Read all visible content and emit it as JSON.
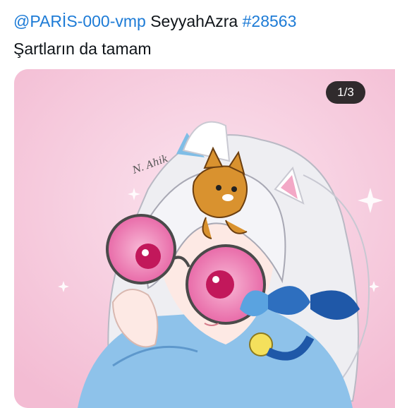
{
  "post": {
    "mention": "@PARİS-000-vmp",
    "user": "SeyyahAzra",
    "hashtag": "#28563",
    "text": "Şartların da tamam"
  },
  "media": {
    "counter": "1/3",
    "image_description": "anime-style drawing of girl with white hair, round pink sunglasses, cat-ear headband and small orange cat on head, blue hoodie",
    "signature": "N. Ahik"
  },
  "colors": {
    "link": "#1d7bd6",
    "text": "#0f1419",
    "background_pink": "#f7cde0"
  }
}
